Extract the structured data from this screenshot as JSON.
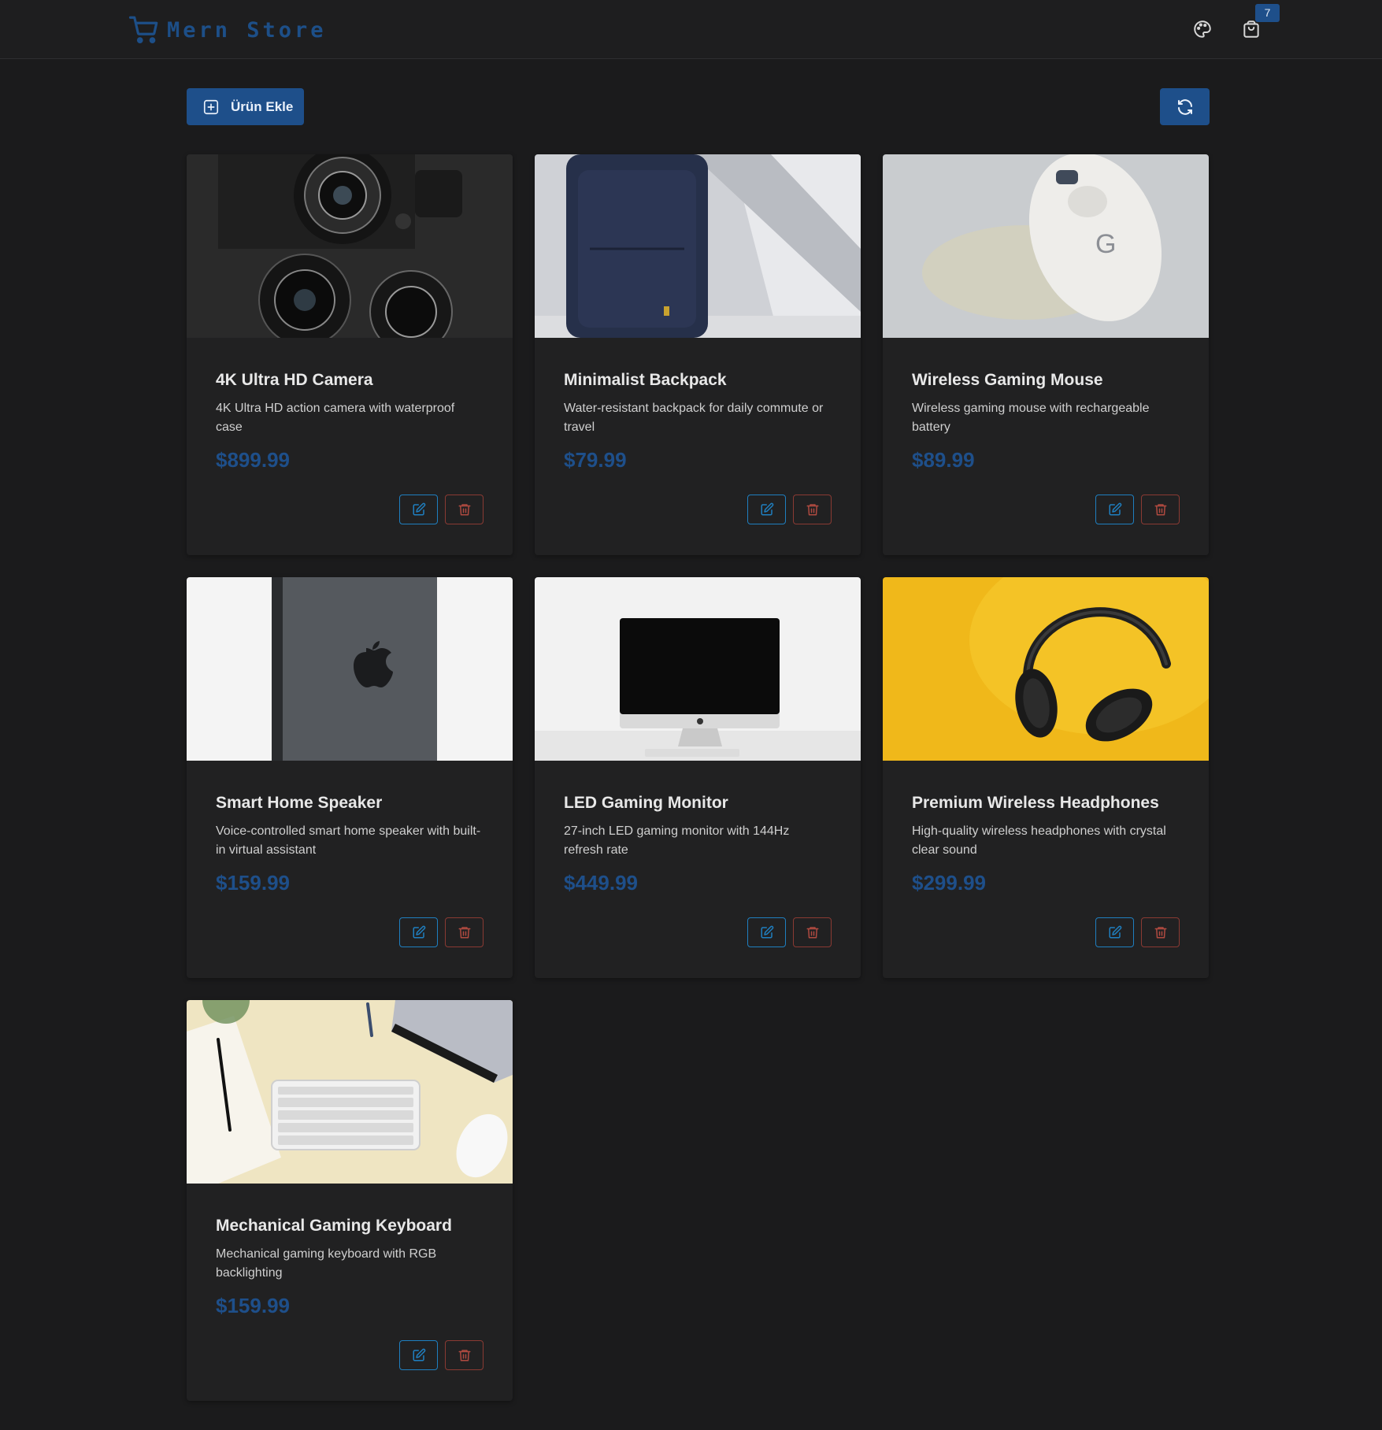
{
  "header": {
    "brand": "Mern Store",
    "cart_count": "7",
    "icons": {
      "brand": "cart-icon",
      "theme": "palette-icon",
      "cart": "shopping-bag-icon"
    }
  },
  "toolbar": {
    "add_label": "Ürün Ekle",
    "add_icon": "plus-square-icon",
    "refresh_icon": "refresh-icon"
  },
  "colors": {
    "accent": "#1e4f8a",
    "edit_border": "#1f7fc0",
    "delete_border": "#8a3a33",
    "background": "#1b1b1c",
    "card": "#212122"
  },
  "products": [
    {
      "title": "4K Ultra HD Camera",
      "description": "4K Ultra HD action camera with waterproof case",
      "price": "$899.99",
      "image": "camera-lenses-photo"
    },
    {
      "title": "Minimalist Backpack",
      "description": "Water-resistant backpack for daily commute or travel",
      "price": "$79.99",
      "image": "navy-backpack-photo"
    },
    {
      "title": "Wireless Gaming Mouse",
      "description": "Wireless gaming mouse with rechargeable battery",
      "price": "$89.99",
      "image": "white-mouse-photo"
    },
    {
      "title": "Smart Home Speaker",
      "description": "Voice-controlled smart home speaker with built-in virtual assistant",
      "price": "$159.99",
      "image": "grey-device-photo"
    },
    {
      "title": "LED Gaming Monitor",
      "description": "27-inch LED gaming monitor with 144Hz refresh rate",
      "price": "$449.99",
      "image": "monitor-photo"
    },
    {
      "title": "Premium Wireless Headphones",
      "description": "High-quality wireless headphones with crystal clear sound",
      "price": "$299.99",
      "image": "headphones-photo"
    },
    {
      "title": "Mechanical Gaming Keyboard",
      "description": "Mechanical gaming keyboard with RGB backlighting",
      "price": "$159.99",
      "image": "keyboard-desk-photo"
    }
  ]
}
